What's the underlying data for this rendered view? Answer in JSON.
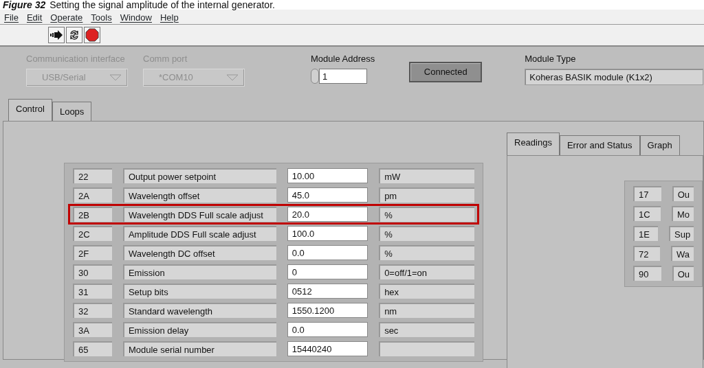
{
  "caption": {
    "label": "Figure 32",
    "text": "Setting the signal amplitude of the internal generator."
  },
  "menu": [
    "File",
    "Edit",
    "Operate",
    "Tools",
    "Window",
    "Help"
  ],
  "toolbar": [
    {
      "kind": "run"
    },
    {
      "kind": "continuous"
    },
    {
      "kind": "abort"
    }
  ],
  "connection": {
    "interface_label": "Communication interface",
    "interface_value": "USB/Serial",
    "port_label": "Comm port",
    "port_value": "*COM10",
    "address_label": "Module Address",
    "address_value": "1",
    "connect_button": "Connected",
    "type_label": "Module Type",
    "type_value": "Koheras BASIK module (K1x2)",
    "disabled": true
  },
  "tabs": [
    {
      "label": "Control",
      "selected": true
    },
    {
      "label": "Loops",
      "selected": false
    }
  ],
  "registers": [
    {
      "id": "22",
      "name": "Output power setpoint",
      "value": "10.00",
      "unit": "mW",
      "highlighted": false
    },
    {
      "id": "2A",
      "name": "Wavelength offset",
      "value": "45.0",
      "unit": "pm",
      "highlighted": false
    },
    {
      "id": "2B",
      "name": "Wavelength DDS Full scale adjust",
      "value": "20.0",
      "unit": "%",
      "highlighted": true
    },
    {
      "id": "2C",
      "name": "Amplitude DDS Full scale adjust",
      "value": "100.0",
      "unit": "%",
      "highlighted": false
    },
    {
      "id": "2F",
      "name": "Wavelength DC offset",
      "value": "0.0",
      "unit": "%",
      "highlighted": false
    },
    {
      "id": "30",
      "name": "Emission",
      "value": "0",
      "unit": "0=off/1=on",
      "highlighted": false
    },
    {
      "id": "31",
      "name": "Setup bits",
      "value": "0512",
      "unit": "hex",
      "highlighted": false
    },
    {
      "id": "32",
      "name": "Standard wavelength",
      "value": "1550.1200",
      "unit": "nm",
      "highlighted": false
    },
    {
      "id": "3A",
      "name": "Emission delay",
      "value": "0.0",
      "unit": "sec",
      "highlighted": false
    },
    {
      "id": "65",
      "name": "Module serial number",
      "value": "15440240",
      "highlighted": false
    }
  ],
  "readings_tabs": [
    {
      "label": "Readings",
      "selected": true
    },
    {
      "label": "Error and Status",
      "selected": false
    },
    {
      "label": "Graph",
      "selected": false
    }
  ],
  "readings": [
    {
      "id": "17",
      "name": "Ou"
    },
    {
      "id": "1C",
      "name": "Mo"
    },
    {
      "id": "1E",
      "name": "Sup"
    },
    {
      "id": "72",
      "name": "Wa"
    },
    {
      "id": "90",
      "name": "Ou"
    }
  ]
}
